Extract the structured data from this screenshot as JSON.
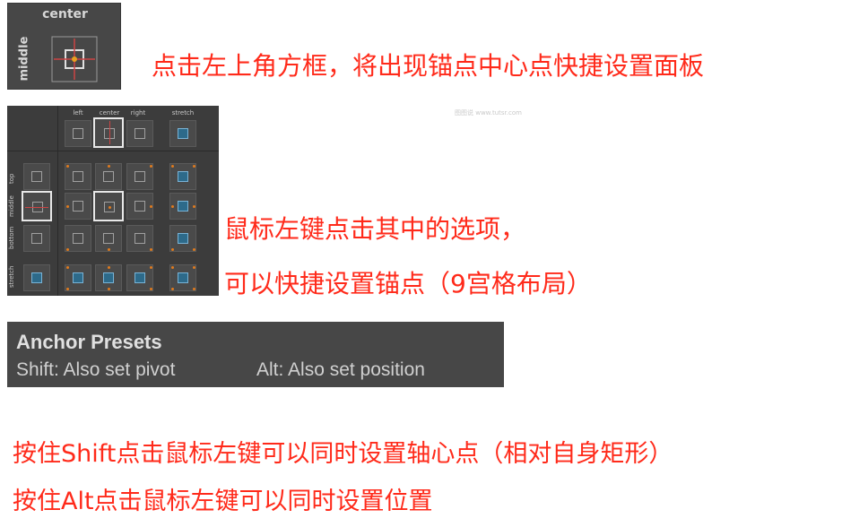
{
  "anchor_button": {
    "top_label": "center",
    "side_label": "middle"
  },
  "notes": {
    "note1": "点击左上角方框，将出现锚点中心点快捷设置面板",
    "note2": "鼠标左键点击其中的选项，",
    "note3": "可以快捷设置锚点（9宫格布局）",
    "note4": "按住Shift点击鼠标左键可以同时设置轴心点（相对自身矩形）",
    "note5": "按住Alt点击鼠标左键可以同时设置位置"
  },
  "preset_grid": {
    "columns": [
      "left",
      "center",
      "right",
      "stretch"
    ],
    "rows": [
      "top",
      "middle",
      "bottom",
      "stretch"
    ],
    "selected": {
      "row": "middle",
      "column": "center"
    }
  },
  "tooltip": {
    "title": "Anchor Presets",
    "shift_hint": "Shift: Also set pivot",
    "alt_hint": "Alt: Also set position"
  },
  "watermark": "图图说 www.tutsr.com",
  "colors": {
    "note_text": "#ff2a1a",
    "panel_bg": "#474747",
    "anchor_dot": "#e07b1e",
    "anchor_line": "#cc4444"
  }
}
